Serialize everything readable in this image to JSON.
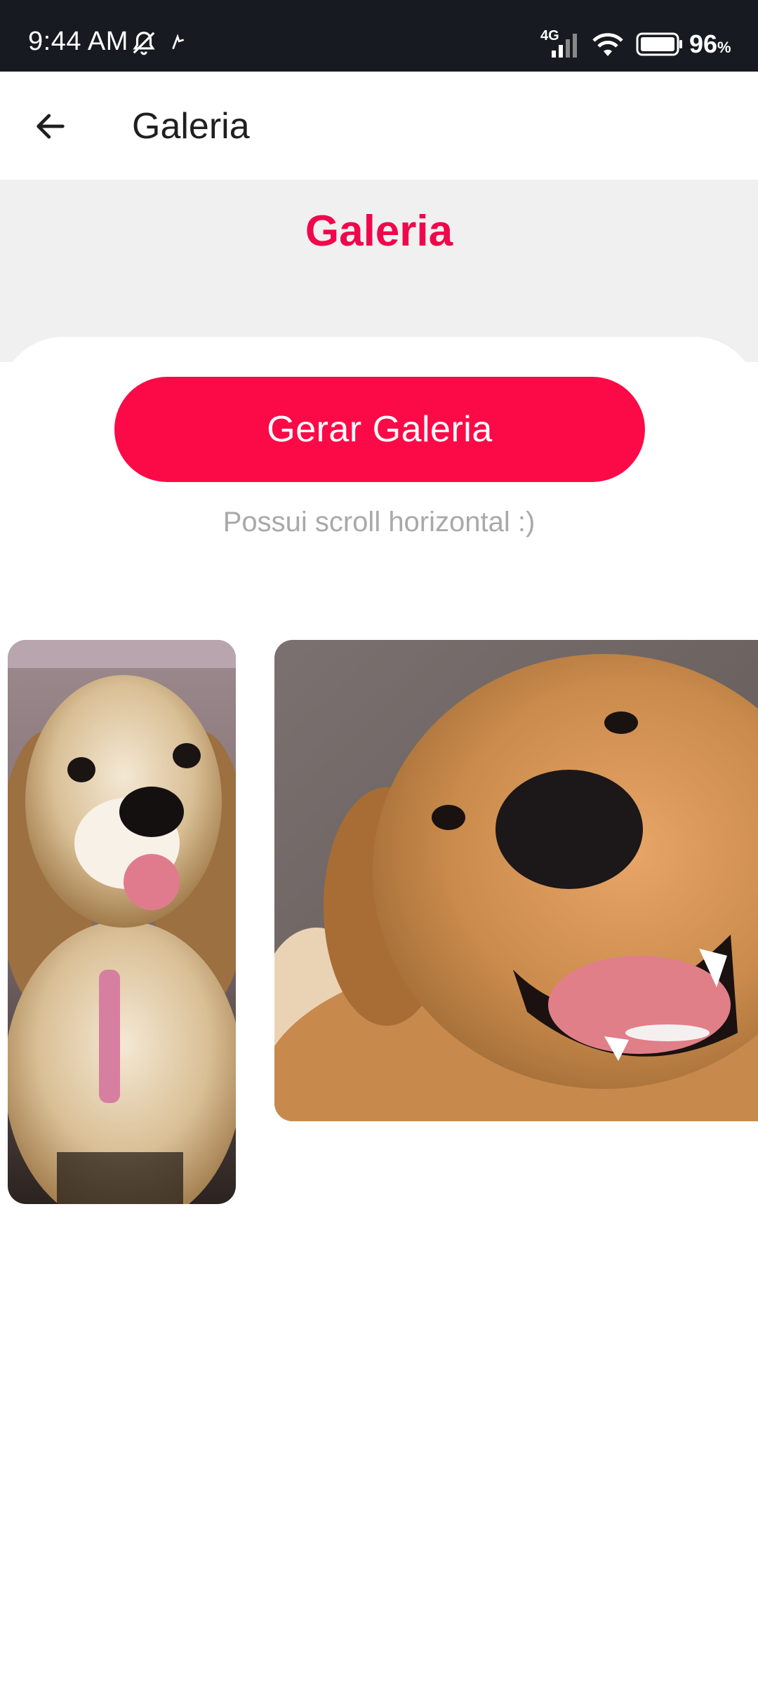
{
  "status_bar": {
    "time": "9:44 AM",
    "network": "4G",
    "battery": "96",
    "battery_unit": "%",
    "icons": [
      "notifications-off-icon",
      "app-notification-icon",
      "cellular-signal-icon",
      "wifi-icon",
      "battery-icon"
    ]
  },
  "app_bar": {
    "title": "Galeria",
    "back_icon": "arrow-back-icon"
  },
  "page": {
    "title": "Galeria",
    "button_label": "Gerar Galeria",
    "hint": "Possui scroll horizontal :)"
  },
  "gallery": {
    "images": [
      {
        "subject": "cocker spaniel puppy with pink leash"
      },
      {
        "subject": "smiling golden retriever"
      }
    ]
  },
  "colors": {
    "accent": "#f0074b",
    "button": "#fc0a47",
    "status_bar": "#171a21",
    "header_bg": "#f0f0f0",
    "hint": "#a9a9a9"
  }
}
